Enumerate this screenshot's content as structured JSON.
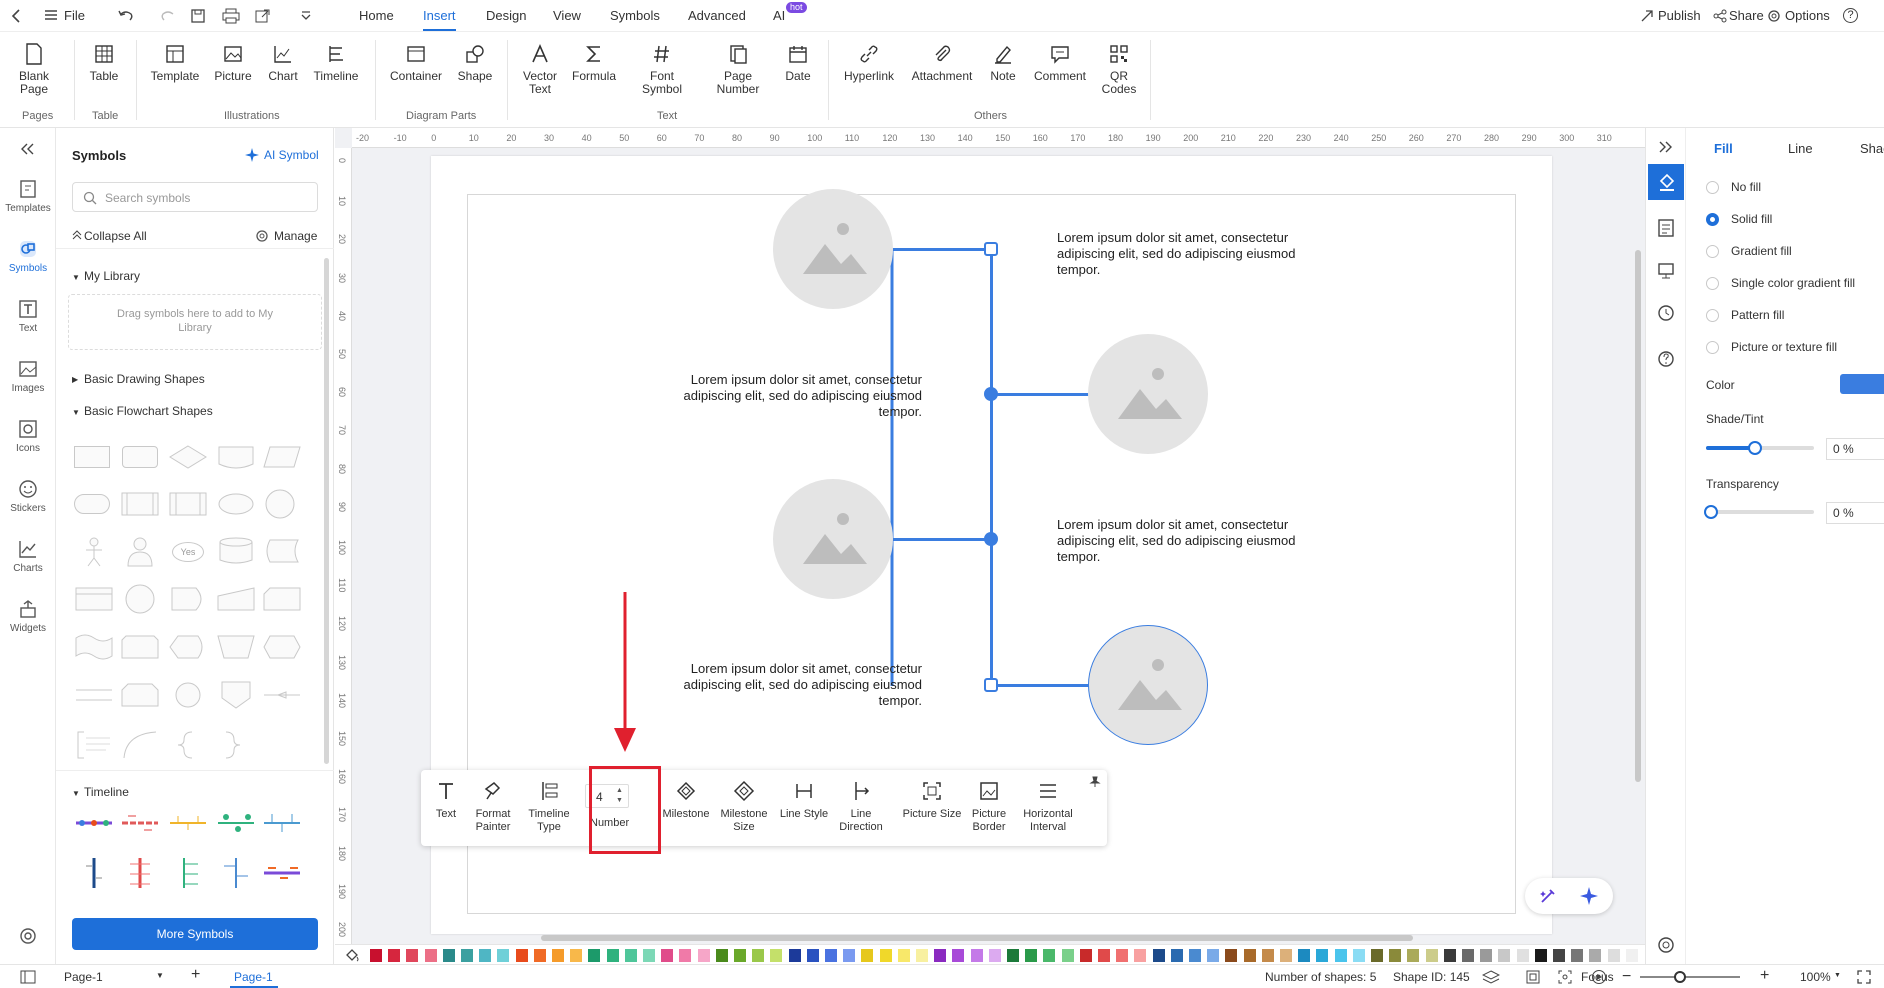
{
  "menubar": {
    "file": "File",
    "tabs": [
      "Home",
      "Insert",
      "Design",
      "View",
      "Symbols",
      "Advanced",
      "AI"
    ],
    "active_tab": "Insert",
    "ai_badge": "hot",
    "publish": "Publish",
    "share": "Share",
    "options": "Options",
    "help": "?"
  },
  "ribbon": {
    "blank_page": "Blank\nPage",
    "table": "Table",
    "template": "Template",
    "picture": "Picture",
    "chart": "Chart",
    "timeline": "Timeline",
    "container": "Container",
    "shape": "Shape",
    "vector_text": "Vector\nText",
    "formula": "Formula",
    "font_symbol": "Font\nSymbol",
    "page_number": "Page\nNumber",
    "date": "Date",
    "hyperlink": "Hyperlink",
    "attachment": "Attachment",
    "note": "Note",
    "comment": "Comment",
    "qr_codes": "QR\nCodes",
    "groups": {
      "pages": "Pages",
      "table": "Table",
      "illustrations": "Illustrations",
      "diagram_parts": "Diagram Parts",
      "text": "Text",
      "others": "Others"
    }
  },
  "rail": {
    "templates": "Templates",
    "symbols": "Symbols",
    "text": "Text",
    "images": "Images",
    "icons": "Icons",
    "stickers": "Stickers",
    "charts": "Charts",
    "widgets": "Widgets"
  },
  "symbols_panel": {
    "title": "Symbols",
    "ai_symbol": "AI Symbol",
    "search_placeholder": "Search symbols",
    "collapse_all": "Collapse All",
    "manage": "Manage",
    "my_library": "My Library",
    "drag_hint": "Drag symbols here to add to My Library",
    "basic_drawing": "Basic Drawing Shapes",
    "basic_flowchart": "Basic Flowchart Shapes",
    "yes_label": "Yes",
    "timeline": "Timeline",
    "more_symbols": "More Symbols"
  },
  "ruler": {
    "h_ticks": [
      "-20",
      "-10",
      "0",
      "10",
      "20",
      "30",
      "40",
      "50",
      "60",
      "70",
      "80",
      "90",
      "100",
      "110",
      "120",
      "130",
      "140",
      "150",
      "160",
      "170",
      "180",
      "190",
      "200",
      "210",
      "220",
      "230",
      "240",
      "250",
      "260",
      "270",
      "280",
      "290",
      "300",
      "310"
    ],
    "v_ticks": [
      "0",
      "10",
      "20",
      "30",
      "40",
      "50",
      "60",
      "70",
      "80",
      "90",
      "100",
      "110",
      "120",
      "130",
      "140",
      "150",
      "160",
      "170",
      "180",
      "190",
      "200"
    ]
  },
  "canvas": {
    "lorem": "Lorem ipsum dolor sit amet, consectetur adipiscing elit, sed do adipiscing eiusmod tempor.",
    "lorem_lines": [
      "Lorem ipsum dolor sit amet, consectetur",
      "adipiscing elit, sed do adipiscing eiusmod",
      "tempor."
    ],
    "accent": "#3a7de0",
    "highlight": "#e0202e"
  },
  "float_toolbar": {
    "text": "Text",
    "format_painter": "Format\nPainter",
    "timeline_type": "Timeline\nType",
    "number_value": "4",
    "number": "Number",
    "milestone": "Milestone",
    "milestone_size": "Milestone\nSize",
    "line_style": "Line Style",
    "line_direction": "Line\nDirection",
    "picture_size": "Picture Size",
    "picture_border": "Picture\nBorder",
    "horizontal_interval": "Horizontal\nInterval"
  },
  "right_panel": {
    "tabs": [
      "Fill",
      "Line",
      "Shac"
    ],
    "active_tab": "Fill",
    "options": [
      "No fill",
      "Solid fill",
      "Gradient fill",
      "Single color gradient fill",
      "Pattern fill",
      "Picture or texture fill"
    ],
    "selected_option": "Solid fill",
    "color_label": "Color",
    "color_value": "#3a7de0",
    "shade_label": "Shade/Tint",
    "shade_value": "0 %",
    "shade_level": 0.55,
    "transparency_label": "Transparency",
    "transparency_value": "0 %",
    "transparency_level": 0
  },
  "palette": [
    "#c8102e",
    "#d6263e",
    "#e0475c",
    "#ec6f86",
    "#2a8a8a",
    "#3ba0a0",
    "#4fb6c4",
    "#6fd0d8",
    "#e84b1c",
    "#f06a26",
    "#f59b2a",
    "#f8b84a",
    "#1c9a6a",
    "#2fb27e",
    "#4fc69a",
    "#7cd8b6",
    "#e04c8a",
    "#f07aa8",
    "#f6a6c8",
    "#4a8a1c",
    "#6aa82a",
    "#9ac84a",
    "#c4e06a",
    "#1c3a9a",
    "#2a52c0",
    "#4a72e0",
    "#7a9af0",
    "#e6c81c",
    "#f0d82a",
    "#f8e86a",
    "#f8f0a0",
    "#8a2ac0",
    "#a84ad8",
    "#c47ae8",
    "#dcaaf0",
    "#1c7a3a",
    "#2a9a4a",
    "#4ab86a",
    "#7ad08a",
    "#c82a2a",
    "#e04a4a",
    "#f07070",
    "#f8a0a0",
    "#1c4a8a",
    "#2a6ab0",
    "#4a8ad0",
    "#7aaae8",
    "#8a4a1c",
    "#a86a2a",
    "#c48a4a",
    "#dcb07a",
    "#1c8ac0",
    "#2aa8d8",
    "#4ac4ec",
    "#8adcf4",
    "#6a6a2a",
    "#8a8a3a",
    "#aaaa5a",
    "#cccc8a",
    "#3a3a3a",
    "#6a6a6a",
    "#9a9a9a",
    "#c8c8c8",
    "#e0e0e0",
    "#1a1a1a",
    "#444444",
    "#777777",
    "#aaaaaa",
    "#dddddd",
    "#f0f0f0"
  ],
  "status": {
    "page_selector": "Page-1",
    "page_tab": "Page-1",
    "shape_count": "Number of shapes: 5",
    "shape_id": "Shape ID: 145",
    "focus": "Focus",
    "zoom": "100%"
  }
}
